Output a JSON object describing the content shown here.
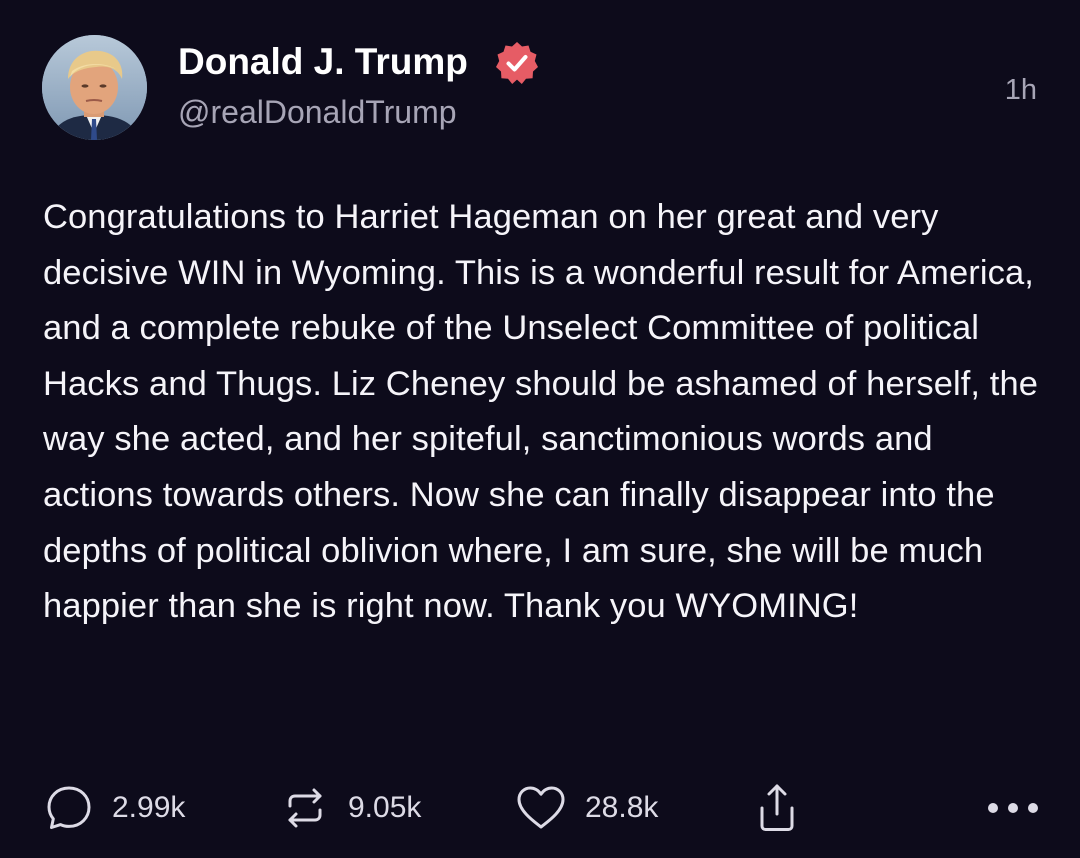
{
  "author": {
    "display_name": "Donald J. Trump",
    "handle": "@realDonaldTrump",
    "verified": true
  },
  "timestamp": "1h",
  "body": "Congratulations to Harriet Hageman on her great and very decisive WIN in Wyoming. This is a wonderful result for America, and a complete rebuke of the Unselect Committee of political Hacks and Thugs. Liz Cheney should be ashamed of herself, the way she acted, and her spiteful, sanctimonious words and actions towards others. Now she can finally disappear into the depths of political oblivion where, I am sure, she will be much happier than she is right now. Thank you WYOMING!",
  "actions": {
    "replies": {
      "icon": "speech-bubble-icon",
      "count": "2.99k"
    },
    "restates": {
      "icon": "repost-arrows-icon",
      "count": "9.05k"
    },
    "likes": {
      "icon": "heart-icon",
      "count": "28.8k"
    },
    "share": {
      "icon": "share-upload-icon"
    },
    "more": {
      "icon": "ellipsis-icon"
    }
  },
  "colors": {
    "background": "#0d0b1b",
    "text": "#f5f4f9",
    "secondary_text": "#a7a5b6",
    "verified_badge": "#e65c65"
  }
}
